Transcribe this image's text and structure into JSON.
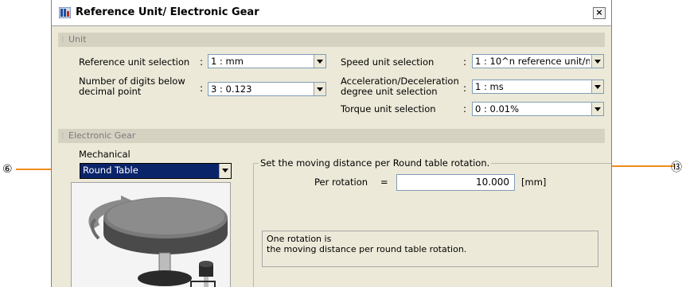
{
  "window": {
    "title": "Reference Unit/ Electronic Gear",
    "close_label": "×"
  },
  "unit_section": {
    "header": "Unit",
    "reference_unit": {
      "label": "Reference unit selection",
      "value": "1 : mm"
    },
    "decimal_digits": {
      "label_line1": "Number of digits below",
      "label_line2": "decimal point",
      "value": "3 : 0.123"
    },
    "speed_unit": {
      "label": "Speed unit selection",
      "value": "1 : 10^n reference unit/m"
    },
    "accel_unit": {
      "label_line1": "Acceleration/Deceleration",
      "label_line2": "degree unit selection",
      "value": "1 : ms"
    },
    "torque_unit": {
      "label": "Torque unit selection",
      "value": "0 : 0.01%"
    }
  },
  "electronic_gear_section": {
    "header": "Electronic Gear",
    "mechanical_label": "Mechanical",
    "mechanical_value": "Round Table",
    "group_legend": "Set the moving distance per Round table rotation.",
    "per_rotation_label": "Per rotation",
    "equals": "=",
    "per_rotation_value": "10.000",
    "unit": "[mm]",
    "info_line1": "One rotation is",
    "info_line2": "the moving distance per round table rotation."
  },
  "callouts": {
    "left": "⑥",
    "right": "⑬",
    "color": "#f08c1e"
  },
  "colon": ":"
}
